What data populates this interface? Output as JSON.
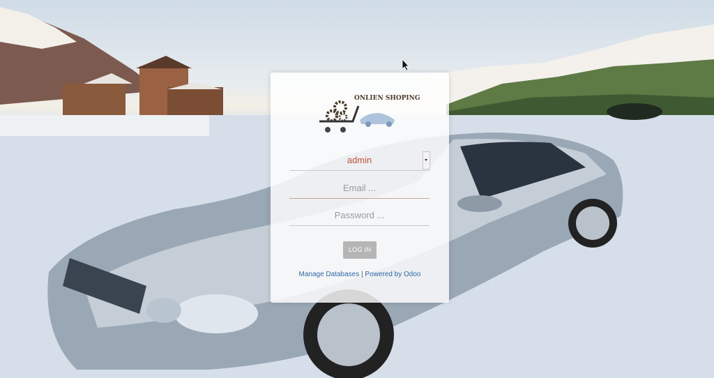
{
  "brand": {
    "logo_text": "ONLIEN SHOPING"
  },
  "login": {
    "database_value": "admin",
    "email_placeholder": "Email ...",
    "password_placeholder": "Password ...",
    "login_label": "LOG IN"
  },
  "footer": {
    "manage_label": "Manage Databases",
    "separator": " | ",
    "powered_label": "Powered by Odoo"
  },
  "colors": {
    "accent": "#c0513a",
    "link": "#2d6aa8",
    "button": "#b5b5b5"
  }
}
